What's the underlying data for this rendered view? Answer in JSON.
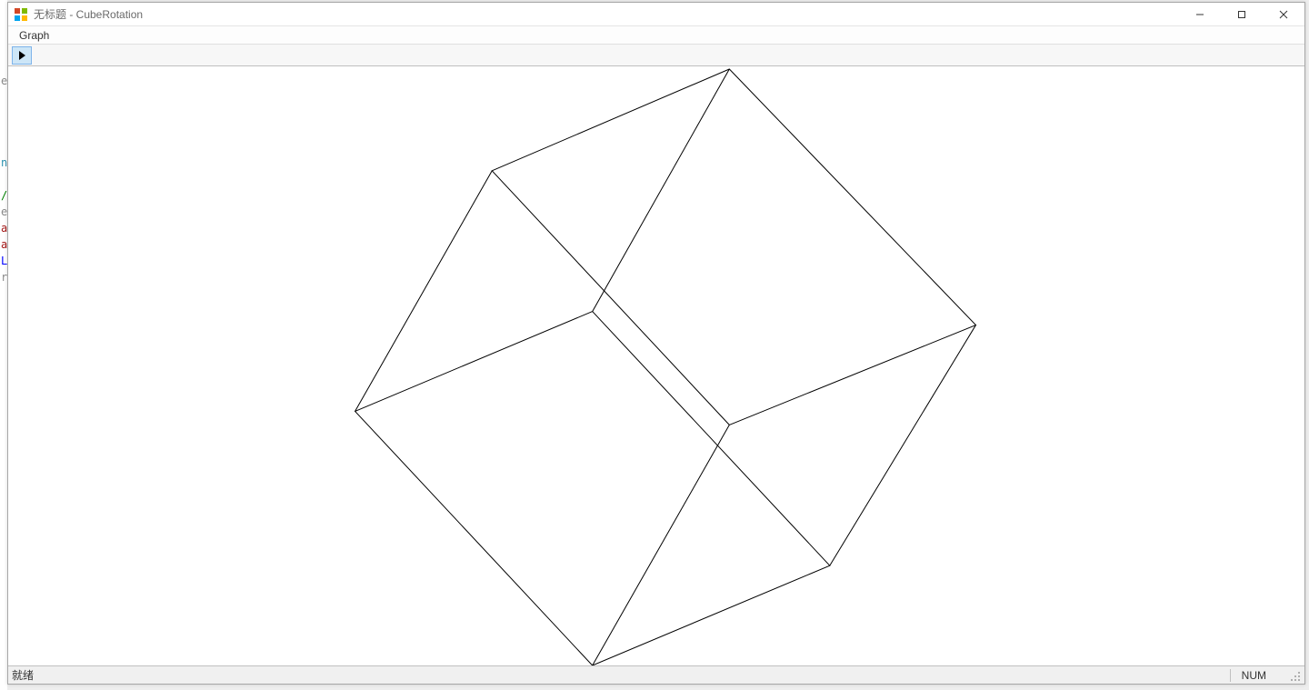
{
  "window": {
    "title": "无标题 - CubeRotation",
    "icon": "app-icon"
  },
  "titlebar_controls": {
    "minimize": "minimize",
    "maximize": "maximize",
    "close": "close"
  },
  "menubar": {
    "items": [
      "Graph"
    ]
  },
  "toolbar": {
    "play_tooltip": "Play"
  },
  "canvas": {
    "cube_vertices_label": "wireframe-cube"
  },
  "statusbar": {
    "ready": "就绪",
    "numlock": "NUM"
  },
  "gutter_chars": [
    "e",
    "",
    "",
    "",
    "",
    "n",
    "",
    "/",
    "e",
    "a",
    "a",
    "L",
    "r"
  ]
}
